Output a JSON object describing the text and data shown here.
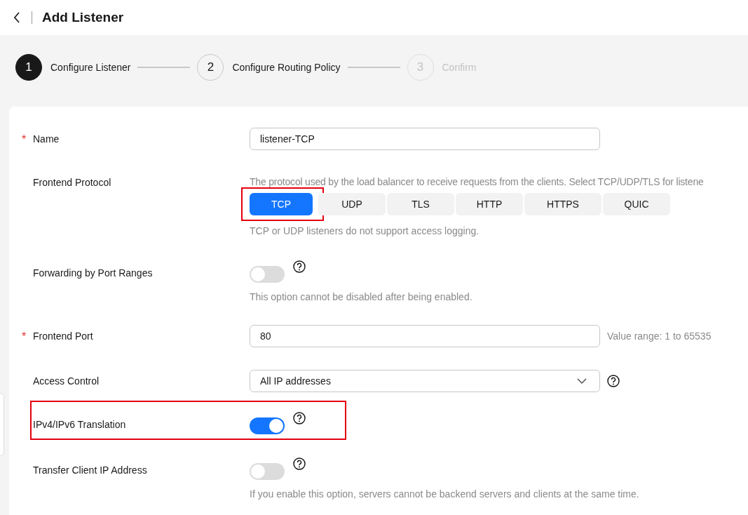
{
  "header": {
    "title": "Add Listener"
  },
  "steps": [
    {
      "number": "1",
      "label": "Configure Listener",
      "current": true,
      "disabled": false
    },
    {
      "number": "2",
      "label": "Configure Routing Policy",
      "current": false,
      "disabled": false
    },
    {
      "number": "3",
      "label": "Confirm",
      "current": false,
      "disabled": true
    }
  ],
  "form": {
    "fields": [
      {
        "kind": "input",
        "required_mark": "*",
        "label": "Name",
        "value": "listener-TCP",
        "highlighted": false
      },
      {
        "kind": "protocol",
        "label": "Frontend Protocol",
        "highlighted": false,
        "description": "The protocol used by the load balancer to receive requests from the clients. Select TCP/UDP/TLS for listene",
        "options": [
          {
            "label": "TCP",
            "selected": true,
            "highlighted": true
          },
          {
            "label": "UDP",
            "selected": false,
            "highlighted": false
          },
          {
            "label": "TLS",
            "selected": false,
            "highlighted": false
          },
          {
            "label": "HTTP",
            "selected": false,
            "highlighted": false
          },
          {
            "label": "HTTPS",
            "selected": false,
            "highlighted": false
          },
          {
            "label": "QUIC",
            "selected": false,
            "highlighted": false
          }
        ],
        "note": "TCP or UDP listeners do not support access logging."
      },
      {
        "kind": "switch",
        "label": "Forwarding by Port Ranges",
        "on": false,
        "help": true,
        "highlighted": false,
        "note": "This option cannot be disabled after being enabled."
      },
      {
        "kind": "input",
        "required_mark": "*",
        "label": "Frontend Port",
        "value": "80",
        "hint": "Value range: 1 to 65535",
        "highlighted": false
      },
      {
        "kind": "select",
        "label": "Access Control",
        "value": "All IP addresses",
        "help": true,
        "highlighted": false
      },
      {
        "kind": "switch",
        "label": "IPv4/IPv6 Translation",
        "on": true,
        "help": true,
        "highlighted": true
      },
      {
        "kind": "switch",
        "label": "Transfer Client IP Address",
        "on": false,
        "help": true,
        "highlighted": false,
        "note": "If you enable this option, servers cannot be backend servers and clients at the same time."
      }
    ]
  }
}
